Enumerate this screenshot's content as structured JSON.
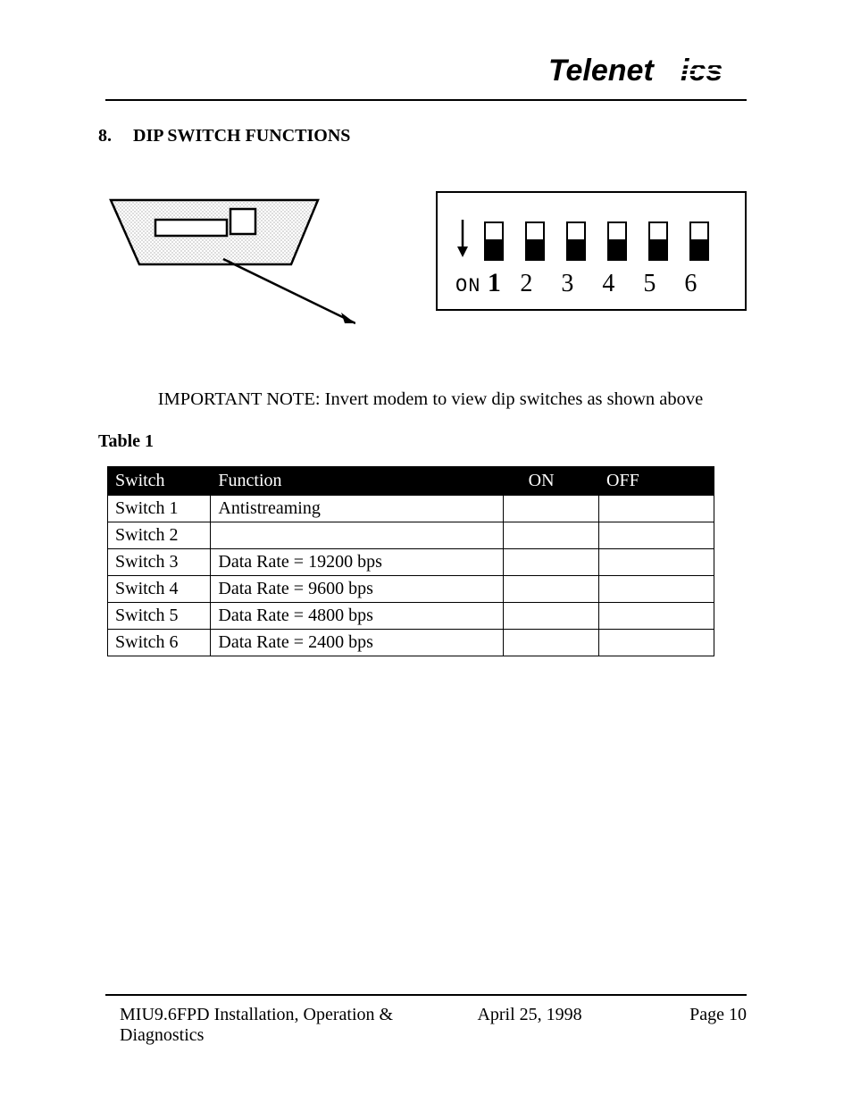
{
  "header": {
    "brand_name": "Telenetics"
  },
  "section": {
    "number": "8.",
    "title": "DIP SWITCH FUNCTIONS"
  },
  "diagram": {
    "on_label": "ON",
    "switch_labels": [
      "1",
      "2",
      "3",
      "4",
      "5",
      "6"
    ]
  },
  "important_note": "IMPORTANT NOTE: Invert modem to view dip switches as shown above",
  "table": {
    "caption": "Table 1",
    "headers": {
      "switch": "Switch",
      "function": "Function",
      "on": "ON",
      "off": "OFF"
    },
    "rows": [
      {
        "switch": "Switch 1",
        "function": "Antistreaming",
        "on": "",
        "off": ""
      },
      {
        "switch": "Switch 2",
        "function": "",
        "on": "",
        "off": ""
      },
      {
        "switch": "Switch 3",
        "function": "Data Rate = 19200 bps",
        "on": "",
        "off": ""
      },
      {
        "switch": "Switch 4",
        "function": "Data Rate = 9600 bps",
        "on": "",
        "off": ""
      },
      {
        "switch": "Switch 5",
        "function": "Data Rate = 4800 bps",
        "on": "",
        "off": ""
      },
      {
        "switch": "Switch 6",
        "function": "Data Rate = 2400 bps",
        "on": "",
        "off": ""
      }
    ]
  },
  "footer": {
    "title": "MIU9.6FPD Installation, Operation & Diagnostics",
    "date": "April 25, 1998",
    "page": "Page 10"
  }
}
